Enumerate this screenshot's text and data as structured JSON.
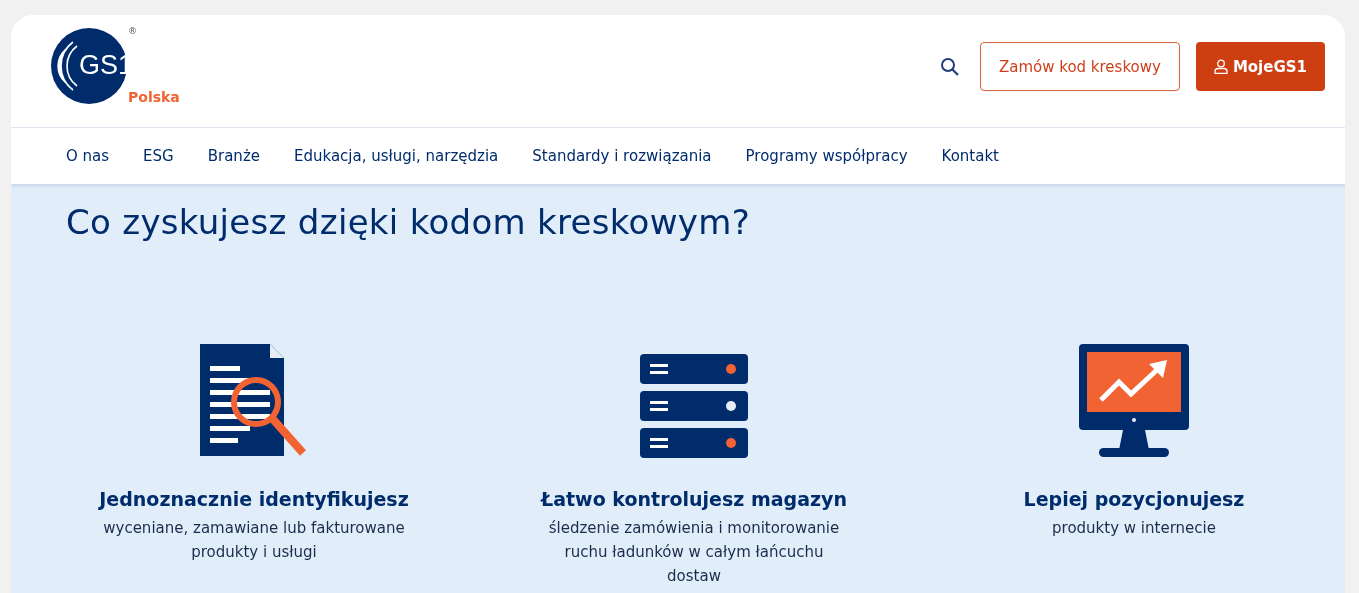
{
  "logo": {
    "mark": "GS1",
    "registered": "®",
    "region": "Polska"
  },
  "header": {
    "order_button": "Zamów kod kreskowy",
    "account_button": "MojeGS1"
  },
  "nav": [
    "O nas",
    "ESG",
    "Branże",
    "Edukacja, usługi, narzędzia",
    "Standardy i rozwiązania",
    "Programy współpracy",
    "Kontakt"
  ],
  "heading": "Co zyskujesz dzięki kodom kreskowym?",
  "benefits": [
    {
      "kind": "document",
      "title": "Jednoznacznie identyfikujesz",
      "lines": [
        "wyceniane, zamawiane lub fakturowane",
        "produkty i usługi"
      ]
    },
    {
      "kind": "server",
      "title": "Łatwo kontrolujesz magazyn",
      "lines": [
        "śledzenie zamówienia i monitorowanie",
        "ruchu ładunków w całym łańcuchu",
        "dostaw"
      ]
    },
    {
      "kind": "monitor",
      "title": "Lepiej pozycjonujesz",
      "lines": [
        "produkty w internecie"
      ]
    }
  ]
}
